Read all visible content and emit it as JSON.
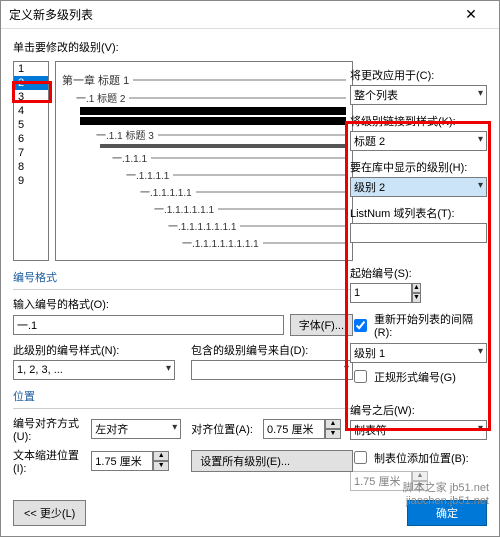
{
  "title": "定义新多级列表",
  "labels": {
    "clickLevel": "单击要修改的级别(V):",
    "applyTo": "将更改应用于(C):",
    "applyToValue": "整个列表",
    "linkStyle": "将级别链接到样式(K):",
    "linkStyleValue": "标题 2",
    "showInGallery": "要在库中显示的级别(H):",
    "showInGalleryValue": "级别 2",
    "listNum": "ListNum 域列表名(T):",
    "listNumValue": "",
    "startAt": "起始编号(S):",
    "startAtValue": "1",
    "restartAfter": "重新开始列表的间隔(R):",
    "restartAfterValue": "级别 1",
    "legalFormat": "正规形式编号(G)",
    "numFormatHdr": "编号格式",
    "enterFormat": "输入编号的格式(O):",
    "enterFormatValue": "一.1",
    "fontBtn": "字体(F)...",
    "numStyle": "此级别的编号样式(N):",
    "numStyleValue": "1, 2, 3, ...",
    "includePrev": "包含的级别编号来自(D):",
    "includePrevValue": "",
    "positionHdr": "位置",
    "alignAt": "编号对齐方式(U):",
    "alignAtValue": "左对齐",
    "alignedAt": "对齐位置(A):",
    "alignedAtValue": "0.75 厘米",
    "indentAt": "文本缩进位置(I):",
    "indentAtValue": "1.75 厘米",
    "setAll": "设置所有级别(E)...",
    "followWith": "编号之后(W):",
    "followWithValue": "制表符",
    "tabStop": "制表位添加位置(B):",
    "tabStopValue": "1.75 厘米",
    "lessBtn": "<< 更少(L)",
    "okBtn": "确定"
  },
  "levels": [
    "1",
    "2",
    "3",
    "4",
    "5",
    "6",
    "7",
    "8",
    "9"
  ],
  "selectedLevel": "2",
  "preview": {
    "l1": "第一章 标题 1",
    "l2": "一.1 标题 2",
    "l3": "一.1.1 标题 3",
    "l4": "一.1.1.1",
    "l5": "一.1.1.1.1",
    "l6": "一.1.1.1.1.1",
    "l7": "一.1.1.1.1.1.1",
    "l8": "一.1.1.1.1.1.1.1",
    "l9": "一.1.1.1.1.1.1.1.1"
  },
  "watermark": {
    "l1": "脚本之家 jb51.net",
    "l2": "jiaochen.jb51.net"
  }
}
